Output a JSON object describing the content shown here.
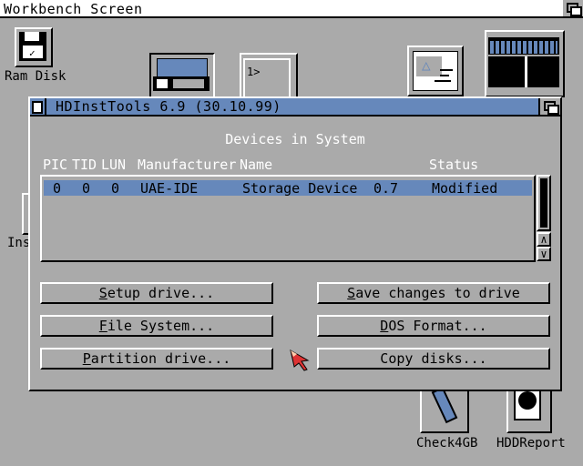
{
  "screen": {
    "title": "Workbench Screen"
  },
  "desktop_icons": [
    {
      "name": "ram-disk",
      "label": "Ram Disk"
    },
    {
      "name": "inst",
      "label": "Ins"
    },
    {
      "name": "check4gb",
      "label": "Check4GB"
    },
    {
      "name": "hddreport",
      "label": "HDDReport"
    }
  ],
  "shell_prompt": "1>",
  "window": {
    "title": "HDInstTools 6.9 (30.10.99)",
    "heading": "Devices in System",
    "columns": [
      "PIC",
      "TID",
      "LUN",
      "Manufacturer",
      "Name",
      "Status"
    ],
    "devices": [
      {
        "pic": "0",
        "tid": "0",
        "lun": "0",
        "manufacturer": "UAE-IDE",
        "name": "Storage Device",
        "revision": "0.7",
        "status": "Modified",
        "selected": true
      }
    ],
    "buttons": {
      "setup": {
        "hotkey": "S",
        "rest": "etup drive..."
      },
      "filesystem": {
        "hotkey": "F",
        "rest": "ile System..."
      },
      "partition": {
        "hotkey": "P",
        "rest": "artition drive..."
      },
      "save": {
        "hotkey": "S",
        "rest": "ave changes to drive"
      },
      "dosformat": {
        "hotkey": "D",
        "rest": "OS Format..."
      },
      "copy": {
        "label": "Copy disks..."
      }
    }
  },
  "colors": {
    "titlebar": "#6688bb",
    "background": "#aaaaaa",
    "pointer": "#dd3333"
  }
}
